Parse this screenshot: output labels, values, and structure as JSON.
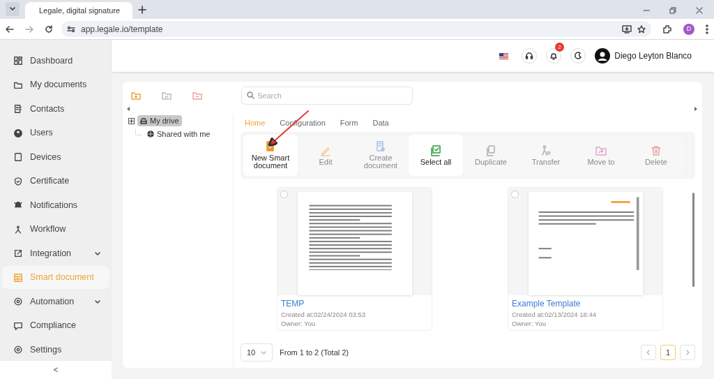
{
  "browser": {
    "tab_title": "Legale, digital signature",
    "url": "app.legale.io/template",
    "profile_initial": "D"
  },
  "sidebar": {
    "items": [
      {
        "label": "Dashboard",
        "selected": false,
        "expandable": false
      },
      {
        "label": "My documents",
        "selected": false,
        "expandable": false
      },
      {
        "label": "Contacts",
        "selected": false,
        "expandable": false
      },
      {
        "label": "Users",
        "selected": false,
        "expandable": false
      },
      {
        "label": "Devices",
        "selected": false,
        "expandable": false
      },
      {
        "label": "Certificate",
        "selected": false,
        "expandable": false
      },
      {
        "label": "Notifications",
        "selected": false,
        "expandable": false
      },
      {
        "label": "Workflow",
        "selected": false,
        "expandable": false
      },
      {
        "label": "Integration",
        "selected": false,
        "expandable": true
      },
      {
        "label": "Smart document",
        "selected": true,
        "expandable": false
      },
      {
        "label": "Automation",
        "selected": false,
        "expandable": true
      },
      {
        "label": "Compliance",
        "selected": false,
        "expandable": false
      },
      {
        "label": "Settings",
        "selected": false,
        "expandable": false
      }
    ],
    "collapse": "<"
  },
  "header": {
    "notification_count": "2",
    "user_name": "Diego Leyton Blanco"
  },
  "search": {
    "placeholder": "Search"
  },
  "tree": [
    {
      "label": "My drive",
      "selected": true,
      "expanded": false
    },
    {
      "label": "Shared with me",
      "selected": false
    }
  ],
  "tabs": [
    {
      "label": "Home",
      "selected": true
    },
    {
      "label": "Configuration",
      "selected": false
    },
    {
      "label": "Form",
      "selected": false
    },
    {
      "label": "Data",
      "selected": false
    }
  ],
  "actions": [
    {
      "label": "New Smart document",
      "disabled": false
    },
    {
      "label": "Edit",
      "disabled": true
    },
    {
      "label": "Create document",
      "disabled": true
    },
    {
      "label": "Select all",
      "disabled": false
    },
    {
      "label": "Duplicate",
      "disabled": true
    },
    {
      "label": "Transfer",
      "disabled": true
    },
    {
      "label": "Move to",
      "disabled": true
    },
    {
      "label": "Delete",
      "disabled": true
    }
  ],
  "documents": [
    {
      "title": "TEMP",
      "created": "Created at:02/24/2024 03:53",
      "owner": "Owner: You",
      "checked": false
    },
    {
      "title": "Example Template",
      "created": "Created at:02/13/2024 18:44",
      "owner": "Owner: You",
      "checked": false
    }
  ],
  "pagination": {
    "page_size": "10",
    "summary": "From 1 to 2 (Total 2)",
    "pages": [
      {
        "label": "1",
        "selected": true
      }
    ]
  }
}
